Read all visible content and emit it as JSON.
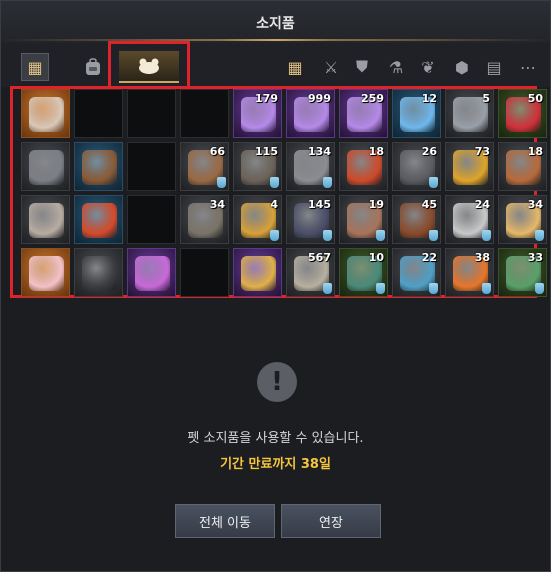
{
  "window": {
    "title": "소지품"
  },
  "tabs": [
    {
      "name": "all",
      "icon": "grid-icon",
      "selected": false
    },
    {
      "name": "bag",
      "icon": "backpack-icon",
      "selected": false
    },
    {
      "name": "pet",
      "icon": "pet-icon",
      "selected": true
    }
  ],
  "categories": [
    {
      "icon": "grid-icon",
      "glyph": "▦"
    },
    {
      "icon": "crossed-swords-icon",
      "glyph": "⚔"
    },
    {
      "icon": "armor-icon",
      "glyph": "⛊"
    },
    {
      "icon": "potion-icon",
      "glyph": "⚗"
    },
    {
      "icon": "leaf-icon",
      "glyph": "❦"
    },
    {
      "icon": "gem-icon",
      "glyph": "⬢"
    },
    {
      "icon": "cards-icon",
      "glyph": "▤"
    },
    {
      "icon": "more-icon",
      "glyph": "⋯"
    }
  ],
  "inventory": [
    {
      "grade": "orange",
      "art": "antler-wreath",
      "count": ""
    },
    {
      "grade": "empty",
      "art": "",
      "count": ""
    },
    {
      "grade": "empty",
      "art": "",
      "count": ""
    },
    {
      "grade": "empty",
      "art": "",
      "count": ""
    },
    {
      "grade": "purple",
      "art": "orb-purple",
      "count": "179"
    },
    {
      "grade": "purple",
      "art": "orb-purple",
      "count": "999"
    },
    {
      "grade": "purple",
      "art": "orb-purple",
      "count": "259"
    },
    {
      "grade": "blue",
      "art": "orb-blue",
      "count": "12"
    },
    {
      "grade": "gray",
      "art": "chest",
      "count": "5"
    },
    {
      "grade": "green",
      "art": "red-potion",
      "count": "50"
    },
    {
      "grade": "gray",
      "art": "stove",
      "count": ""
    },
    {
      "grade": "blue",
      "art": "drum",
      "count": ""
    },
    {
      "grade": "empty",
      "art": "",
      "count": ""
    },
    {
      "grade": "gray",
      "art": "pinecone",
      "count": "66"
    },
    {
      "grade": "gray",
      "art": "claw",
      "count": "115"
    },
    {
      "grade": "gray",
      "art": "fang",
      "count": "134"
    },
    {
      "grade": "gray",
      "art": "rooster",
      "count": "18"
    },
    {
      "grade": "gray",
      "art": "spiked-ball",
      "count": "26"
    },
    {
      "grade": "gray",
      "art": "gold-pot",
      "count": "73"
    },
    {
      "grade": "gray",
      "art": "gingerbread",
      "count": "18"
    },
    {
      "grade": "gray",
      "art": "rabbit",
      "count": ""
    },
    {
      "grade": "blue",
      "art": "lion-mask",
      "count": ""
    },
    {
      "grade": "empty",
      "art": "",
      "count": ""
    },
    {
      "grade": "gray",
      "art": "wolf",
      "count": "34"
    },
    {
      "grade": "gray",
      "art": "beak",
      "count": "4"
    },
    {
      "grade": "gray",
      "art": "horn",
      "count": "145"
    },
    {
      "grade": "gray",
      "art": "drumstick",
      "count": "19"
    },
    {
      "grade": "gray",
      "art": "brown-orb",
      "count": "45"
    },
    {
      "grade": "gray",
      "art": "egg-silver",
      "count": "24"
    },
    {
      "grade": "gray",
      "art": "honey-jar",
      "count": "34"
    },
    {
      "grade": "orange",
      "art": "egg-pink",
      "count": ""
    },
    {
      "grade": "gray",
      "art": "frying-pan",
      "count": ""
    },
    {
      "grade": "purple",
      "art": "silhouette",
      "count": ""
    },
    {
      "grade": "empty",
      "art": "",
      "count": ""
    },
    {
      "grade": "purple",
      "art": "antler-gold",
      "count": ""
    },
    {
      "grade": "gray",
      "art": "stones",
      "count": "567"
    },
    {
      "grade": "green",
      "art": "moss",
      "count": "10"
    },
    {
      "grade": "gray",
      "art": "shell",
      "count": "22"
    },
    {
      "grade": "gray",
      "art": "fire-orb",
      "count": "38"
    },
    {
      "grade": "green",
      "art": "bottle",
      "count": "33"
    }
  ],
  "notice": {
    "message": "펫 소지품을 사용할 수 있습니다.",
    "expiry": "기간 만료까지 38일"
  },
  "buttons": {
    "move_all": "전체 이동",
    "extend": "연장"
  },
  "colors": {
    "accent_gold": "#c9a86a",
    "expiry_text": "#f4c53d",
    "highlight_box": "#e0232a"
  }
}
